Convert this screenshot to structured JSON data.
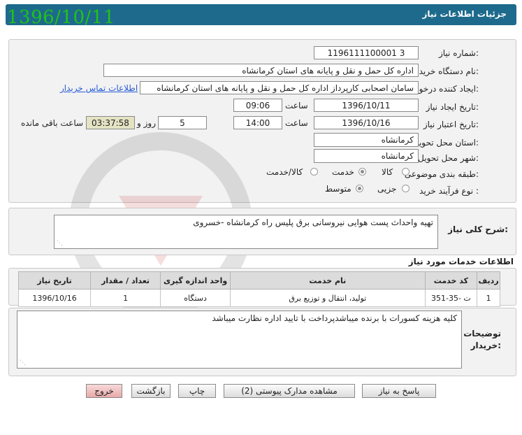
{
  "header": {
    "title": "جزئیات اطلاعات نیاز",
    "date_stamp": "1396/10/11"
  },
  "form": {
    "need_number_label": "شماره نیاز:",
    "need_number": "1196111100001 3",
    "buyer_org_label": "نام دستگاه خریدار:",
    "buyer_org": "اداره کل حمل و نقل و پایانه های استان کرمانشاه",
    "requester_label": "ایجاد کننده درخواست:",
    "requester": "سامان  اصحابی کارپرداز اداره کل حمل و نقل و پایانه های استان کرمانشاه",
    "contact_link": "اطلاعات تماس خریدار",
    "created_label": "تاریخ ایجاد نیاز:",
    "created_date": "1396/10/11",
    "time_label": "ساعت",
    "created_time": "09:06",
    "valid_label": "تاریخ اعتبار نیاز:",
    "valid_date": "1396/10/16",
    "valid_time": "14:00",
    "days_value": "5",
    "days_label": "روز و",
    "remaining_time": "03:37:58",
    "remaining_label": "ساعت باقی مانده",
    "province_label": "استان محل تحویل:",
    "province": "کرمانشاه",
    "city_label": "شهر محل تحویل:",
    "city": "کرمانشاه",
    "category_label": "طبقه بندی موضوعی:",
    "category_options": [
      "کالا",
      "خدمت",
      "کالا/خدمت"
    ],
    "purchase_type_label": "نوع فرآیند خرید :",
    "purchase_options": [
      "جزیی",
      "متوسط"
    ]
  },
  "description": {
    "label": "شرح کلی نیاز:",
    "text": "تهیه واحداث پست هوایی نیروسانی برق پلیس راه کرمانشاه -خسروی"
  },
  "services": {
    "section_title": "اطلاعات خدمات مورد نیاز",
    "columns": [
      "ردیف",
      "کد خدمت",
      "نام خدمت",
      "واحد اندازه گیری",
      "تعداد / مقدار",
      "تاریخ نیاز"
    ],
    "rows": [
      [
        "1",
        "ت -35-351",
        "تولید، انتقال و توزیع برق",
        "دستگاه",
        "1",
        "1396/10/16"
      ]
    ]
  },
  "buyer_notes": {
    "label_line1": "توضیحات",
    "label_line2": "خریدار:",
    "text": "کلیه هزینه کسورات با برنده میباشدپرداخت با تایید اداره نظارت میباشد"
  },
  "buttons": {
    "reply": "پاسخ به نیاز",
    "attachments": "مشاهده مدارک پیوستی (2)",
    "print": "چاپ",
    "back": "بازگشت",
    "exit": "خروج"
  },
  "colors": {
    "titlebar": "#1d6a8c",
    "stamp": "#22c21a",
    "link": "#2a5bd6"
  }
}
